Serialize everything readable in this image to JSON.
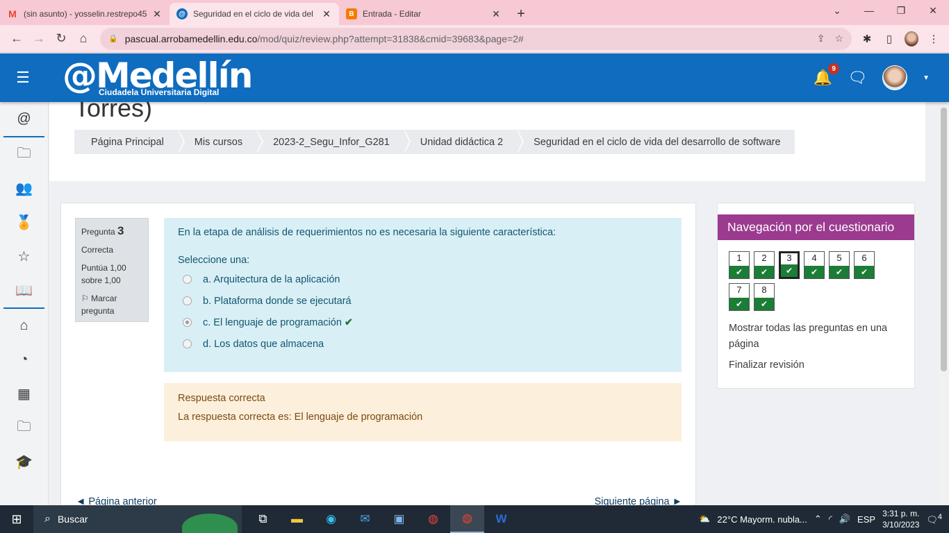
{
  "browser": {
    "tabs": [
      {
        "label": "(sin asunto) - yosselin.restrepo45",
        "favicon": "M",
        "favicon_color": "#ea4335",
        "active": false
      },
      {
        "label": "Seguridad en el ciclo de vida del",
        "favicon": "@",
        "favicon_color": "#0f6cbf",
        "active": true
      },
      {
        "label": "Entrada - Editar",
        "favicon": "B",
        "favicon_color": "#f57c00",
        "active": false
      }
    ],
    "new_tab": "+",
    "window_controls": [
      "⌄",
      "—",
      "❐",
      "✕"
    ],
    "url_host": "pascual.arrobamedellin.edu.co",
    "url_path": "/mod/quiz/review.php?attempt=31838&cmid=39683&page=2#"
  },
  "header": {
    "logo_main": "@Medellín",
    "logo_sub": "Ciudadela Universitaria Digital",
    "notification_count": "9"
  },
  "page": {
    "course_title": "Torres)",
    "breadcrumb": [
      "Página Principal",
      "Mis cursos",
      "2023-2_Segu_Infor_G281",
      "Unidad didáctica 2",
      "Seguridad en el ciclo de vida del desarrollo de software"
    ]
  },
  "question": {
    "label": "Pregunta",
    "number": "3",
    "state": "Correcta",
    "score": "Puntúa 1,00 sobre 1,00",
    "flag": "Marcar pregunta",
    "text": "En la etapa de análisis de requerimientos no es necesaria la siguiente característica:",
    "prompt": "Seleccione una:",
    "options": [
      {
        "label": "a. Arquitectura de la aplicación",
        "checked": false
      },
      {
        "label": "b. Plataforma donde se ejecutará",
        "checked": false
      },
      {
        "label": "c. El lenguaje de programación",
        "checked": true
      },
      {
        "label": "d. Los datos que almacena",
        "checked": false
      }
    ],
    "feedback_title": "Respuesta correcta",
    "feedback_text": "La respuesta correcta es: El lenguaje de programación"
  },
  "pager": {
    "prev": "◄ Página anterior",
    "next": "Siguiente página ►"
  },
  "quiz_nav": {
    "title": "Navegación por el cuestionario",
    "buttons": [
      "1",
      "2",
      "3",
      "4",
      "5",
      "6",
      "7",
      "8"
    ],
    "current": "3",
    "show_all": "Mostrar todas las preguntas en una página",
    "finish": "Finalizar revisión"
  },
  "taskbar": {
    "search": "Buscar",
    "weather": "22°C  Mayorm. nubla...",
    "lang": "ESP",
    "time": "3:31 p. m.",
    "date": "3/10/2023",
    "notifications": "4"
  },
  "colors": {
    "brand": "#0f6cbf",
    "nav_header": "#9b3a8f",
    "correct": "#1b7d36"
  }
}
